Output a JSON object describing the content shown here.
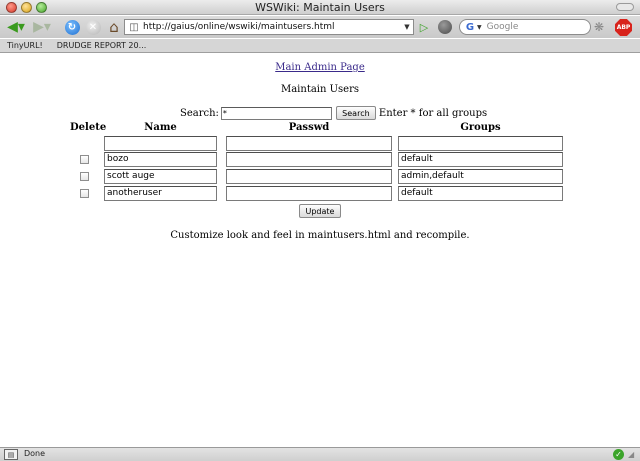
{
  "window": {
    "title": "WSWiki: Maintain Users"
  },
  "toolbar": {
    "url": "http://gaius/online/wswiki/maintusers.html",
    "search_placeholder": "Google",
    "adblock_label": "ABP"
  },
  "bookmarks": [
    "TinyURL!",
    "DRUDGE REPORT 20..."
  ],
  "page": {
    "admin_link": "Main Admin Page",
    "heading": "Maintain Users",
    "search_label": "Search:",
    "search_value": "*",
    "search_button": "Search",
    "search_hint": "Enter * for all groups",
    "columns": {
      "delete": "Delete",
      "name": "Name",
      "passwd": "Passwd",
      "groups": "Groups"
    },
    "new_row": {
      "name": "",
      "passwd": "",
      "groups": ""
    },
    "users": [
      {
        "name": "bozo",
        "passwd": "",
        "groups": "default",
        "delete": false
      },
      {
        "name": "scott auge",
        "passwd": "",
        "groups": "admin,default",
        "delete": false
      },
      {
        "name": "anotheruser",
        "passwd": "",
        "groups": "default",
        "delete": false
      }
    ],
    "update_button": "Update",
    "footer_note": "Customize look and feel in maintusers.html and recompile."
  },
  "status": {
    "text": "Done"
  },
  "icons": {
    "back": "back-arrow-icon",
    "forward": "forward-arrow-icon",
    "reload": "reload-icon",
    "stop": "stop-icon",
    "home": "home-icon",
    "go": "go-arrow-icon",
    "search_engine": "google-icon",
    "adblock": "adblock-plus-icon",
    "security": "secure-check-icon"
  },
  "colors": {
    "link": "#3a2a8a",
    "go_green": "#3fa32a",
    "adblock_red": "#d8231c"
  }
}
